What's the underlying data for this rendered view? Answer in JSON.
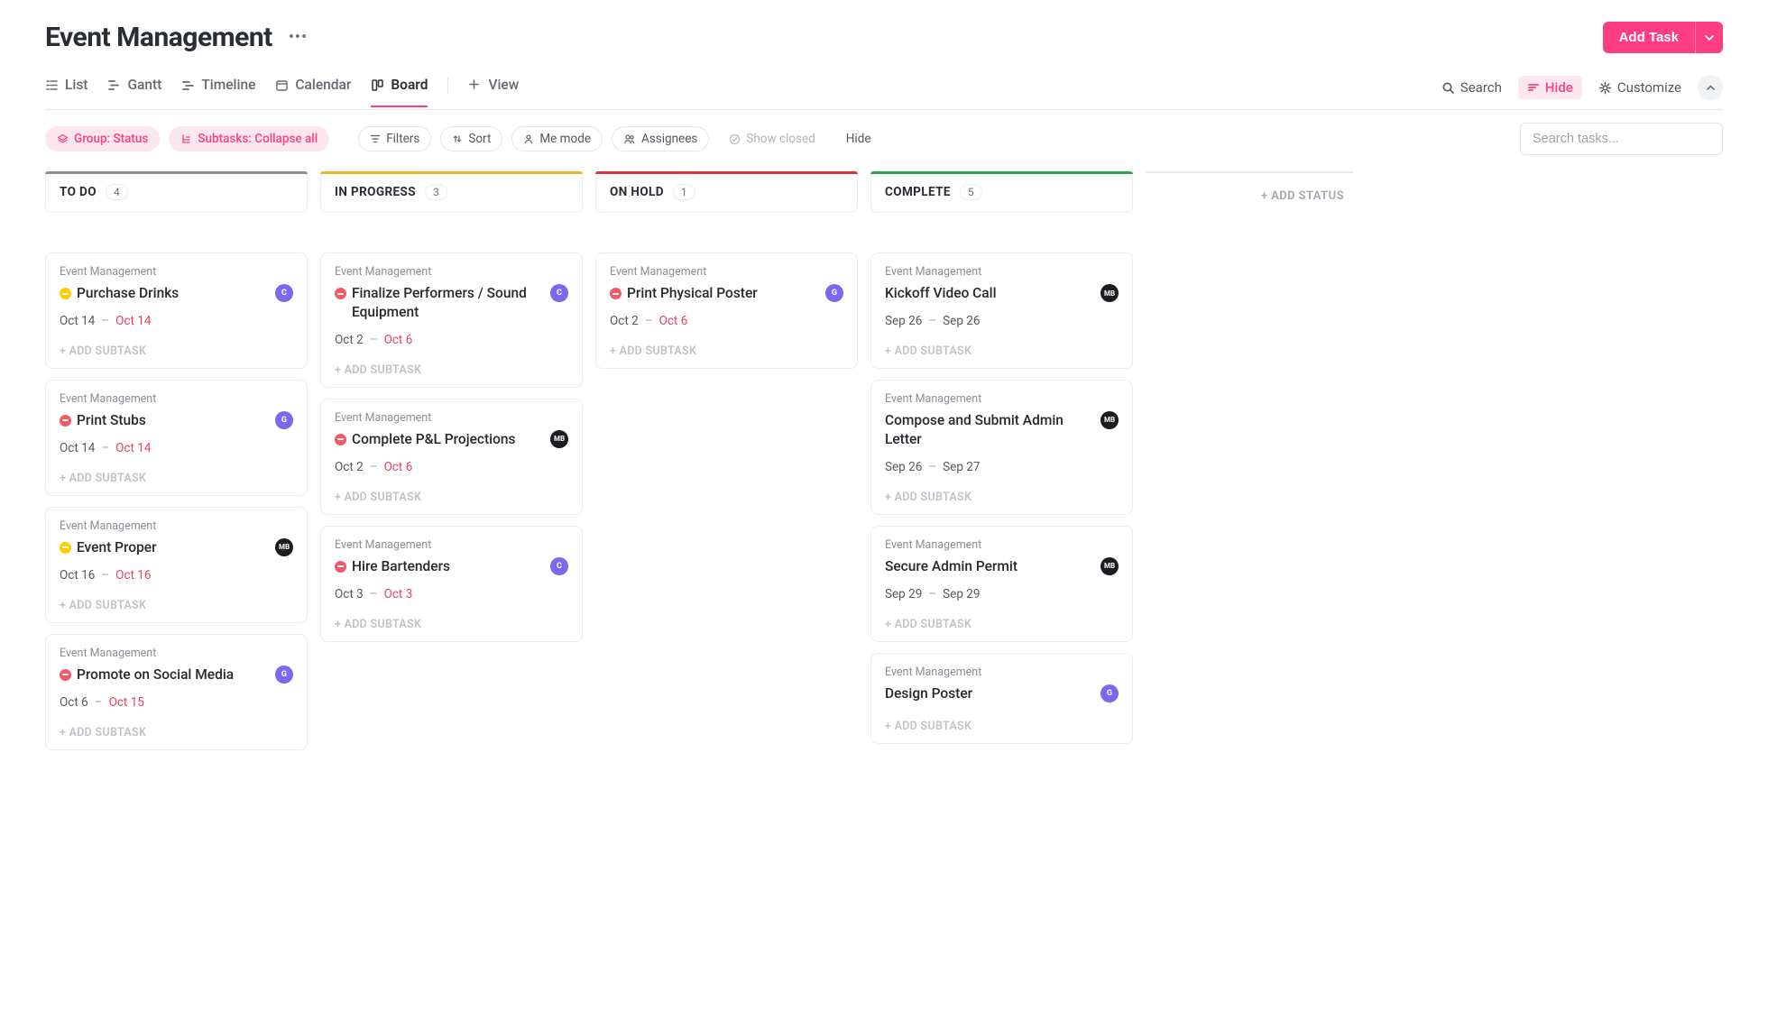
{
  "header": {
    "title": "Event Management",
    "add_task_label": "Add Task"
  },
  "views": {
    "tabs": [
      {
        "label": "List"
      },
      {
        "label": "Gantt"
      },
      {
        "label": "Timeline"
      },
      {
        "label": "Calendar"
      },
      {
        "label": "Board",
        "active": true
      },
      {
        "label": "View",
        "is_add": true
      }
    ],
    "search_label": "Search",
    "hide_label": "Hide",
    "customize_label": "Customize"
  },
  "toolbar": {
    "group_label": "Group: Status",
    "subtasks_label": "Subtasks: Collapse all",
    "filters_label": "Filters",
    "sort_label": "Sort",
    "me_mode_label": "Me mode",
    "assignees_label": "Assignees",
    "show_closed_label": "Show closed",
    "hide_label": "Hide",
    "search_placeholder": "Search tasks..."
  },
  "board": {
    "add_status_label": "+ ADD STATUS",
    "add_subtask_label": "ADD SUBTASK",
    "columns": [
      {
        "key": "todo",
        "title": "TO DO",
        "count": "4",
        "bar": "#8a8d93",
        "cards": [
          {
            "folder": "Event Management",
            "title": "Purchase Drinks",
            "prio": "yellow",
            "assignee": {
              "initials": "C",
              "cls": "av-c"
            },
            "start": "Oct 14",
            "due": "Oct 14",
            "overdue": true
          },
          {
            "folder": "Event Management",
            "title": "Print Stubs",
            "prio": "red",
            "assignee": {
              "initials": "G",
              "cls": "av-g"
            },
            "start": "Oct 14",
            "due": "Oct 14",
            "overdue": true
          },
          {
            "folder": "Event Management",
            "title": "Event Proper",
            "prio": "yellow",
            "assignee": {
              "initials": "MB",
              "cls": "av-mb"
            },
            "start": "Oct 16",
            "due": "Oct 16",
            "overdue": true
          },
          {
            "folder": "Event Management",
            "title": "Promote on Social Media",
            "prio": "red",
            "assignee": {
              "initials": "G",
              "cls": "av-g"
            },
            "start": "Oct 6",
            "due": "Oct 15",
            "overdue": true
          }
        ]
      },
      {
        "key": "inprogress",
        "title": "IN PROGRESS",
        "count": "3",
        "bar": "#f0b429",
        "cards": [
          {
            "folder": "Event Management",
            "title": "Finalize Performers / Sound Equipment",
            "prio": "red",
            "assignee": {
              "initials": "C",
              "cls": "av-c"
            },
            "start": "Oct 2",
            "due": "Oct 6",
            "overdue": true
          },
          {
            "folder": "Event Management",
            "title": "Complete P&L Projections",
            "prio": "red",
            "assignee": {
              "initials": "MB",
              "cls": "av-mb"
            },
            "start": "Oct 2",
            "due": "Oct 6",
            "overdue": true
          },
          {
            "folder": "Event Management",
            "title": "Hire Bartenders",
            "prio": "red",
            "assignee": {
              "initials": "C",
              "cls": "av-c"
            },
            "start": "Oct 3",
            "due": "Oct 3",
            "overdue": true
          }
        ]
      },
      {
        "key": "onhold",
        "title": "ON HOLD",
        "count": "1",
        "bar": "#e02e3d",
        "cards": [
          {
            "folder": "Event Management",
            "title": "Print Physical Poster",
            "prio": "red",
            "assignee": {
              "initials": "G",
              "cls": "av-g"
            },
            "start": "Oct 2",
            "due": "Oct 6",
            "overdue": true
          }
        ]
      },
      {
        "key": "complete",
        "title": "COMPLETE",
        "count": "5",
        "bar": "#2ea44f",
        "cards": [
          {
            "folder": "Event Management",
            "title": "Kickoff Video Call",
            "prio": "none",
            "assignee": {
              "initials": "MB",
              "cls": "av-mb"
            },
            "start": "Sep 26",
            "due": "Sep 26",
            "overdue": false
          },
          {
            "folder": "Event Management",
            "title": "Compose and Submit Admin Letter",
            "prio": "none",
            "assignee": {
              "initials": "MB",
              "cls": "av-mb"
            },
            "start": "Sep 26",
            "due": "Sep 27",
            "overdue": false
          },
          {
            "folder": "Event Management",
            "title": "Secure Admin Permit",
            "prio": "none",
            "assignee": {
              "initials": "MB",
              "cls": "av-mb"
            },
            "start": "Sep 29",
            "due": "Sep 29",
            "overdue": false
          },
          {
            "folder": "Event Management",
            "title": "Design Poster",
            "prio": "none",
            "assignee": {
              "initials": "G",
              "cls": "av-g"
            },
            "start": "",
            "due": "",
            "overdue": false
          }
        ]
      }
    ]
  }
}
